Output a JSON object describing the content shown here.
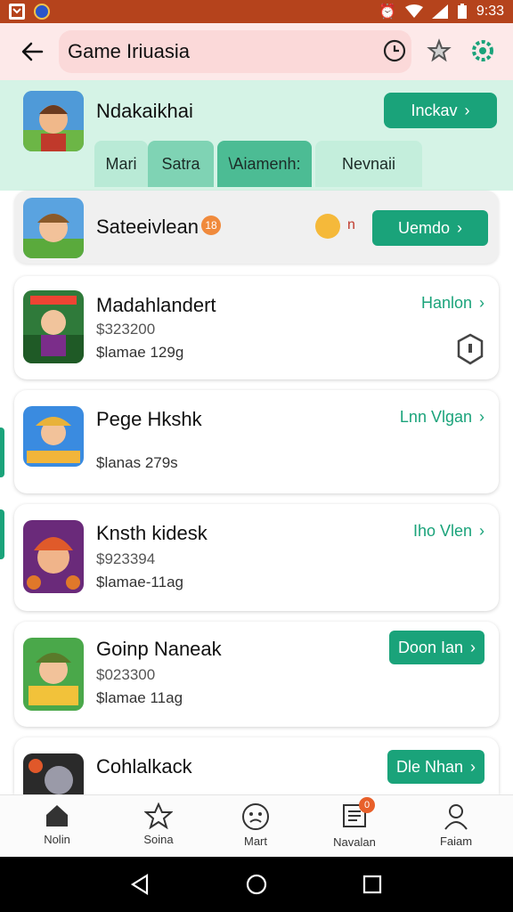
{
  "status_bar": {
    "time": "9:33"
  },
  "header": {
    "search_value": "Game Iriuasia"
  },
  "featured": {
    "title": "Ndakaikhai",
    "button_label": "Inckav",
    "tabs": [
      "Mari",
      "Satra",
      "\\Aiamenh:",
      "Nevnaii"
    ]
  },
  "top_row": {
    "name": "Sateeivlean",
    "badge": "18",
    "extra": "n",
    "button_label": "Uemdo"
  },
  "games": [
    {
      "name": "Madahlandert",
      "line1": "$323200",
      "line2": "$lamae 129g",
      "action": "Hanlon"
    },
    {
      "name": "Pege Hkshk",
      "line1": "",
      "line2": "$lanas 279s",
      "action": "Lnn Vlgan"
    },
    {
      "name": "Knsth kidesk",
      "line1": "$923394",
      "line2": "$lamae-11ag",
      "action": "Iho Vlen"
    },
    {
      "name": "Goinp Naneak",
      "line1": "$023300",
      "line2": "$lamae 11ag",
      "action": "Doon Ian"
    },
    {
      "name": "Cohlalkack",
      "line1": "",
      "line2": "",
      "action": "Dle Nhan"
    }
  ],
  "bottom_nav": [
    {
      "label": "Nolin",
      "icon": "home-icon"
    },
    {
      "label": "Soina",
      "icon": "star-icon"
    },
    {
      "label": "Mart",
      "icon": "face-icon"
    },
    {
      "label": "Navalan",
      "icon": "news-icon",
      "badge": "0"
    },
    {
      "label": "Faiam",
      "icon": "profile-icon"
    }
  ],
  "colors": {
    "accent": "#1aa37a",
    "status_bar": "#b5431c",
    "header_bg": "#fde9e9",
    "featured_bg": "#d5f3e6"
  }
}
